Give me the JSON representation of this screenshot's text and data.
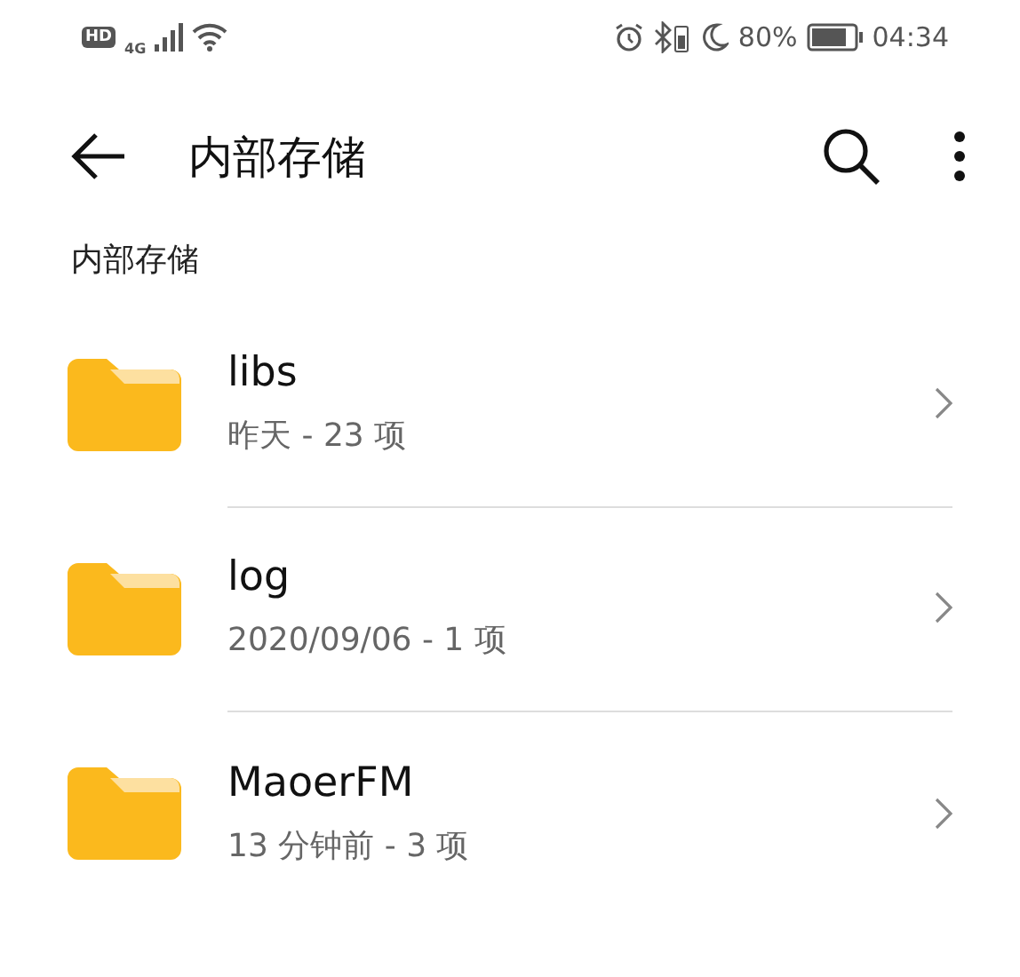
{
  "status_bar": {
    "hd": "HD",
    "network": "4G",
    "battery": "80%",
    "time": "04:34"
  },
  "header": {
    "title": "内部存储"
  },
  "breadcrumb": "内部存储",
  "folders": [
    {
      "name": "libs",
      "detail": "昨天 - 23 项"
    },
    {
      "name": "log",
      "detail": "2020/09/06 - 1 项"
    },
    {
      "name": "MaoerFM",
      "detail": "13 分钟前 - 3 项"
    }
  ]
}
